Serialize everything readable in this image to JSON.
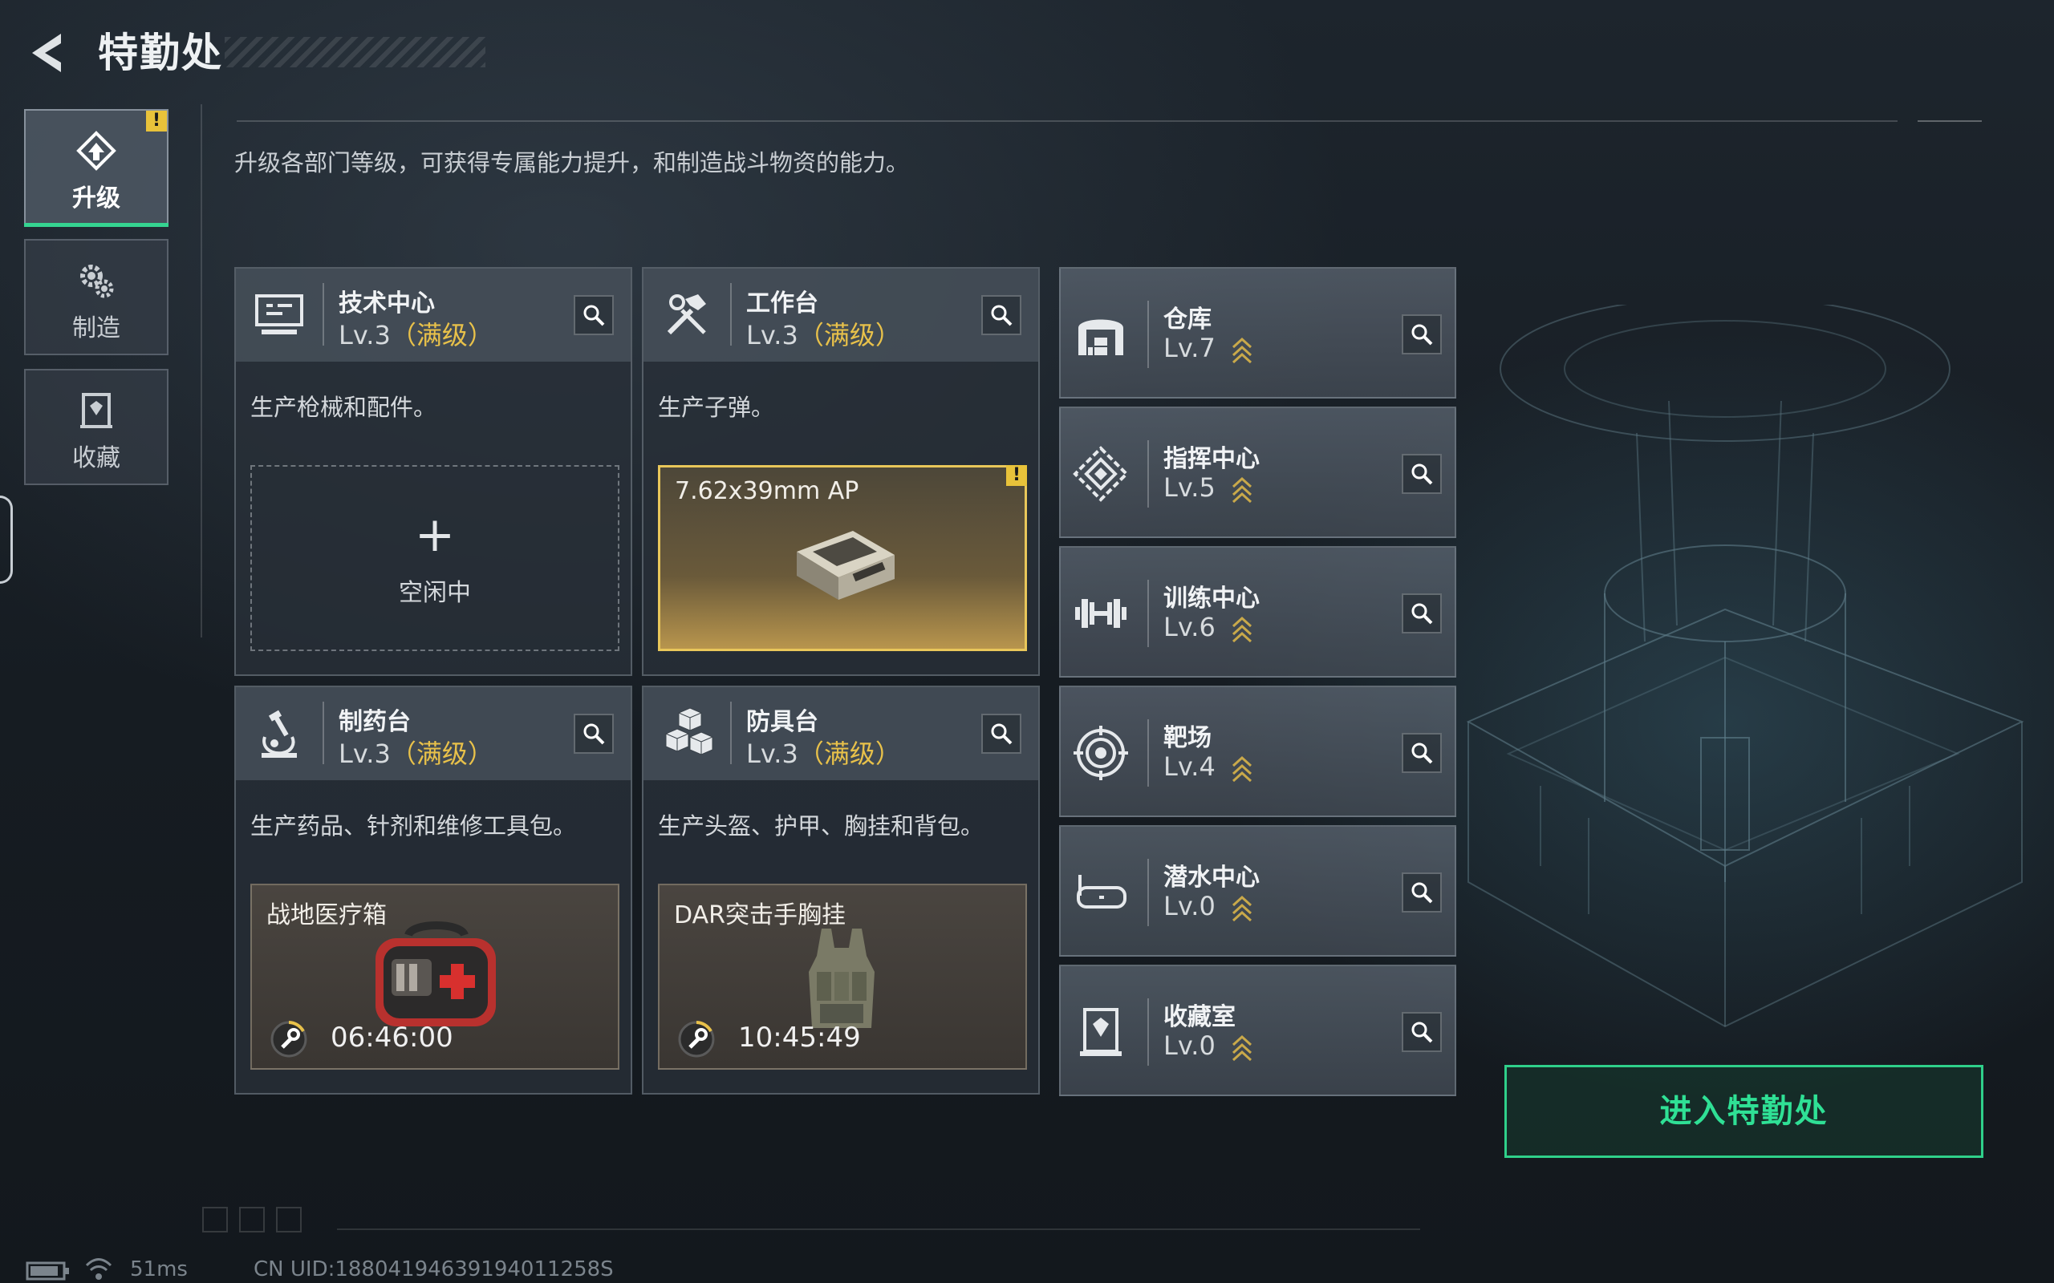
{
  "header": {
    "title": "特勤处"
  },
  "subtitle": "升级各部门等级，可获得专属能力提升，和制造战斗物资的能力。",
  "tabs": [
    {
      "label": "升级",
      "icon": "upgrade-icon",
      "active": true,
      "warning": "!"
    },
    {
      "label": "制造",
      "icon": "gears-icon",
      "active": false
    },
    {
      "label": "收藏",
      "icon": "collection-icon",
      "active": false
    }
  ],
  "workshops": [
    {
      "name": "技术中心",
      "level": "Lv.3",
      "max": "（满级）",
      "desc": "生产枪械和配件。",
      "icon": "computer-icon",
      "slot": {
        "state": "idle",
        "plus": "+",
        "label": "空闲中"
      }
    },
    {
      "name": "工作台",
      "level": "Lv.3",
      "max": "（满级）",
      "desc": "生产子弹。",
      "icon": "hammer-wrench-icon",
      "slot": {
        "state": "done",
        "item": "7.62x39mm AP",
        "warning": "!"
      }
    },
    {
      "name": "制药台",
      "level": "Lv.3",
      "max": "（满级）",
      "desc": "生产药品、针剂和维修工具包。",
      "icon": "microscope-icon",
      "slot": {
        "state": "crafting",
        "item": "战地医疗箱",
        "timer": "06:46:00"
      }
    },
    {
      "name": "防具台",
      "level": "Lv.3",
      "max": "（满级）",
      "desc": "生产头盔、护甲、胸挂和背包。",
      "icon": "armor-boxes-icon",
      "slot": {
        "state": "crafting",
        "item": "DAR突击手胸挂",
        "timer": "10:45:49"
      }
    }
  ],
  "facilities": [
    {
      "name": "仓库",
      "level": "Lv.7",
      "icon": "warehouse-icon"
    },
    {
      "name": "指挥中心",
      "level": "Lv.5",
      "icon": "command-center-icon"
    },
    {
      "name": "训练中心",
      "level": "Lv.6",
      "icon": "dumbbell-icon"
    },
    {
      "name": "靶场",
      "level": "Lv.4",
      "icon": "target-icon"
    },
    {
      "name": "潜水中心",
      "level": "Lv.0",
      "icon": "diving-mask-icon"
    },
    {
      "name": "收藏室",
      "level": "Lv.0",
      "icon": "collection-room-icon"
    }
  ],
  "enter_button": "进入特勤处",
  "footer": {
    "ping": "51ms",
    "uid": "CN UID:18804194639194011258S"
  },
  "colors": {
    "accent_green": "#2fd08a",
    "gold": "#e8c14a",
    "warning": "#e8c23a"
  }
}
